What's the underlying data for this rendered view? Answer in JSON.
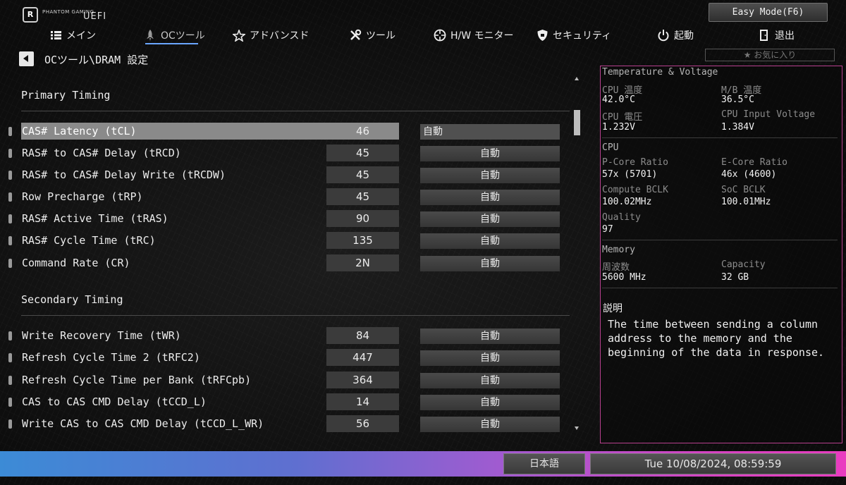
{
  "header": {
    "logo_text": "PHANTOM GAMING",
    "logo_sub": "UEFI",
    "easy_mode_label": "Easy Mode(F6)",
    "favorites_label": "★ お気に入り"
  },
  "nav": {
    "main": "メイン",
    "oc_tool": "OCツール",
    "advanced": "アドバンスド",
    "tool": "ツール",
    "hw_monitor": "H/W モニター",
    "security": "セキュリティ",
    "boot": "起動",
    "exit": "退出",
    "active": "OCツール"
  },
  "breadcrumb": "OCツール\\DRAM 設定",
  "primary": {
    "title": "Primary Timing",
    "rows": [
      {
        "label": "CAS# Latency (tCL)",
        "value": "46",
        "option": "自動"
      },
      {
        "label": "RAS# to CAS# Delay (tRCD)",
        "value": "45",
        "option": "自動"
      },
      {
        "label": "RAS# to CAS# Delay Write (tRCDW)",
        "value": "45",
        "option": "自動"
      },
      {
        "label": "Row Precharge (tRP)",
        "value": "45",
        "option": "自動"
      },
      {
        "label": "RAS# Active Time (tRAS)",
        "value": "90",
        "option": "自動"
      },
      {
        "label": "RAS# Cycle Time (tRC)",
        "value": "135",
        "option": "自動"
      },
      {
        "label": "Command Rate (CR)",
        "value": "2N",
        "option": "自動"
      }
    ]
  },
  "secondary": {
    "title": "Secondary Timing",
    "rows": [
      {
        "label": "Write Recovery Time (tWR)",
        "value": "84",
        "option": "自動"
      },
      {
        "label": "Refresh Cycle Time 2 (tRFC2)",
        "value": "447",
        "option": "自動"
      },
      {
        "label": "Refresh Cycle Time per Bank (tRFCpb)",
        "value": "364",
        "option": "自動"
      },
      {
        "label": "CAS to CAS CMD Delay (tCCD_L)",
        "value": "14",
        "option": "自動"
      },
      {
        "label": "Write CAS to CAS CMD Delay (tCCD_L_WR)",
        "value": "56",
        "option": "自動"
      }
    ]
  },
  "panel": {
    "temp_voltage": {
      "title": "Temperature & Voltage",
      "cpu_temp_label": "CPU 温度",
      "cpu_temp": "42.0°C",
      "mb_temp_label": "M/B 温度",
      "mb_temp": "36.5°C",
      "cpu_volt_label": "CPU 電圧",
      "cpu_volt": "1.232V",
      "cpu_input_label": "CPU Input Voltage",
      "cpu_input": "1.384V"
    },
    "cpu": {
      "title": "CPU",
      "pcore_label": "P-Core Ratio",
      "pcore": "57x (5701)",
      "ecore_label": "E-Core Ratio",
      "ecore": "46x (4600)",
      "compute_label": "Compute BCLK",
      "compute": "100.02MHz",
      "soc_label": "SoC BCLK",
      "soc": "100.01MHz",
      "quality_label": "Quality",
      "quality": "97"
    },
    "memory": {
      "title": "Memory",
      "freq_label": "周波数",
      "freq": "5600 MHz",
      "cap_label": "Capacity",
      "cap": "32 GB"
    },
    "description": {
      "title": "説明",
      "text": "The time between sending a column address to the memory and the beginning of the data in response."
    }
  },
  "footer": {
    "language": "日本語",
    "datetime": "Tue 10/08/2024, 08:59:59"
  },
  "colors": {
    "panel_border": "#b8408f",
    "nav_active_underline": "#6aa6ff",
    "selected_row": "#8a8a8a",
    "footer_gradient_start": "#3c8bd6",
    "footer_gradient_end": "#e93cc0"
  },
  "icons": {
    "main": "list-icon",
    "oc_tool": "rocket-icon",
    "advanced": "star-icon",
    "tool": "wrench-icon",
    "hw_monitor": "crosshair-icon",
    "security": "shield-icon",
    "boot": "power-icon",
    "exit": "door-icon",
    "back": "back-arrow-icon"
  }
}
